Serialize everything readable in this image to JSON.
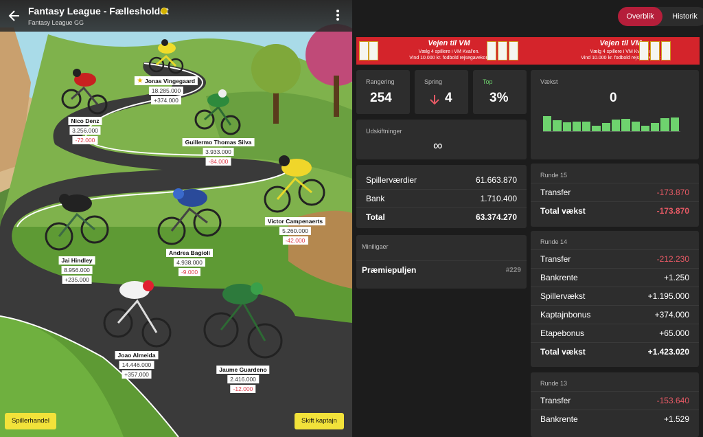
{
  "header": {
    "title": "Fantasy League - Fællesholdet",
    "subtitle": "Fantasy League GG"
  },
  "riders": [
    {
      "name": "Jonas Vingegaard",
      "value": "18.285.000",
      "change": "+374.000",
      "captain": true
    },
    {
      "name": "Nico Denz",
      "value": "3.256.000",
      "change": "-72.000"
    },
    {
      "name": "Guillermo Thomas Silva",
      "value": "3.933.000",
      "change": "-84.000"
    },
    {
      "name": "Victor Campenaerts",
      "value": "5.260.000",
      "change": "-42.000"
    },
    {
      "name": "Jai Hindley",
      "value": "8.956.000",
      "change": "+235.000"
    },
    {
      "name": "Andrea Bagioli",
      "value": "4.938.000",
      "change": "-9.000"
    },
    {
      "name": "Joao Almeida",
      "value": "14.446.000",
      "change": "+357.000"
    },
    {
      "name": "Jaume Guardeno",
      "value": "2.416.000",
      "change": "-12.000"
    }
  ],
  "buttons": {
    "trade": "Spillerhandel",
    "captain": "Skift kaptajn"
  },
  "tabs": {
    "overview": "Overblik",
    "history": "Historik"
  },
  "banner": {
    "title": "Vejen til VM",
    "line1": "Vælg 4 spillere i VM Kval'en.",
    "line2": "Vind 10.000 kr. fodbold rejsegavekort"
  },
  "stats": {
    "ranking_label": "Rangering",
    "ranking_value": "254",
    "jump_label": "Spring",
    "jump_value": "4",
    "top_label": "Top",
    "top_value": "3%",
    "growth_label": "Vækst",
    "growth_value": "0",
    "growth_bars": [
      0.9,
      0.65,
      0.55,
      0.6,
      0.6,
      0.35,
      0.5,
      0.7,
      0.75,
      0.6,
      0.35,
      0.5,
      0.8,
      0.85
    ],
    "subs_label": "Udskiftninger",
    "subs_value": "∞"
  },
  "values": {
    "player_label": "Spillerværdier",
    "player_value": "61.663.870",
    "bank_label": "Bank",
    "bank_value": "1.710.400",
    "total_label": "Total",
    "total_value": "63.374.270"
  },
  "minileagues": {
    "label": "Miniligaer",
    "item_name": "Præmiepuljen",
    "item_rank": "#229"
  },
  "rounds": [
    {
      "title": "Runde 15",
      "rows": [
        {
          "label": "Transfer",
          "value": "-173.870"
        },
        {
          "label": "Total vækst",
          "value": "-173.870"
        }
      ]
    },
    {
      "title": "Runde 14",
      "rows": [
        {
          "label": "Transfer",
          "value": "-212.230"
        },
        {
          "label": "Bankrente",
          "value": "+1.250"
        },
        {
          "label": "Spillervækst",
          "value": "+1.195.000"
        },
        {
          "label": "Kaptajnbonus",
          "value": "+374.000"
        },
        {
          "label": "Etapebonus",
          "value": "+65.000"
        },
        {
          "label": "Total vækst",
          "value": "+1.423.020"
        }
      ]
    },
    {
      "title": "Runde 13",
      "rows": [
        {
          "label": "Transfer",
          "value": "-153.640"
        },
        {
          "label": "Bankrente",
          "value": "+1.529"
        }
      ]
    }
  ],
  "colors": {
    "accent": "#b51e3a",
    "positive_bar": "#6ed36e",
    "negative": "#e85a65",
    "button_yellow": "#f2e23a"
  }
}
